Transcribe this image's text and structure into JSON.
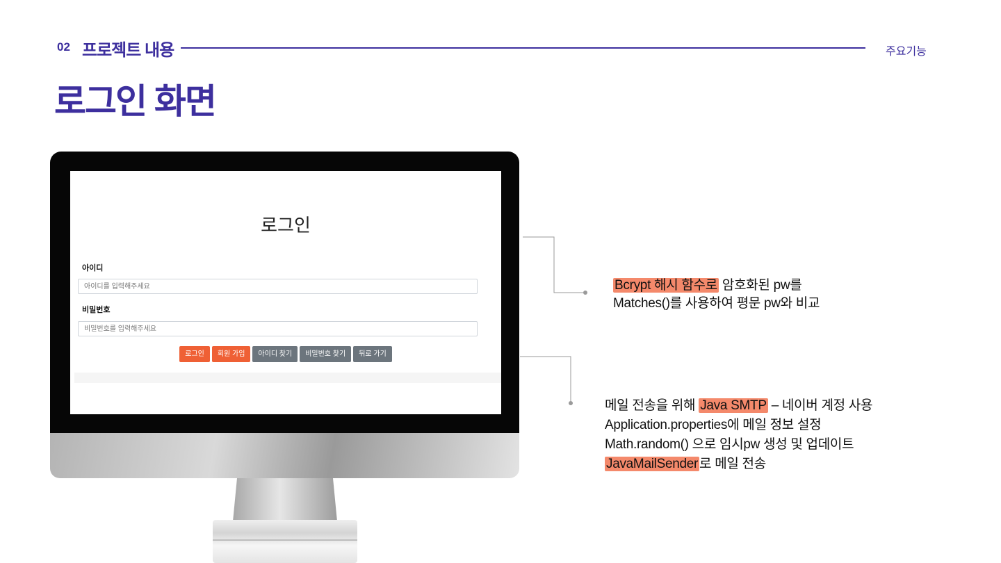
{
  "header": {
    "section_number": "02",
    "section_title": "프로젝트 내용",
    "section_right": "주요기능",
    "page_title": "로그인 화면"
  },
  "login_screen": {
    "heading": "로그인",
    "id_label": "아이디",
    "id_placeholder": "아이디를 입력해주세요",
    "pw_label": "비밀번호",
    "pw_placeholder": "비밀번호를 입력해주세요",
    "buttons": [
      {
        "label": "로그인",
        "style": "primary"
      },
      {
        "label": "회원 가입",
        "style": "primary"
      },
      {
        "label": "아이디 찾기",
        "style": "secondary"
      },
      {
        "label": "비밀번호 찾기",
        "style": "secondary"
      },
      {
        "label": "뒤로 가기",
        "style": "secondary"
      }
    ]
  },
  "callout1": {
    "line1_highlight": "Bcrypt 해시 함수로",
    "line1_rest": " 암호화된 pw를",
    "line2": "Matches()를 사용하여 평문 pw와 비교"
  },
  "callout2": {
    "line1_pre": "메일 전송을 위해",
    "line1_highlight": "Java SMTP",
    "line1_post": "– 네이버 계정 사용",
    "line2": "Application.properties에 메일 정보 설정",
    "line3": "Math.random() 으로 임시pw 생성 및 업데이트",
    "line4_highlight": "JavaMailSender",
    "line4_post": "로 메일 전송"
  },
  "colors": {
    "accent": "#3d2f9e",
    "highlight": "#f4896b",
    "primary_button": "#ef6035",
    "secondary_button": "#6c757d"
  }
}
